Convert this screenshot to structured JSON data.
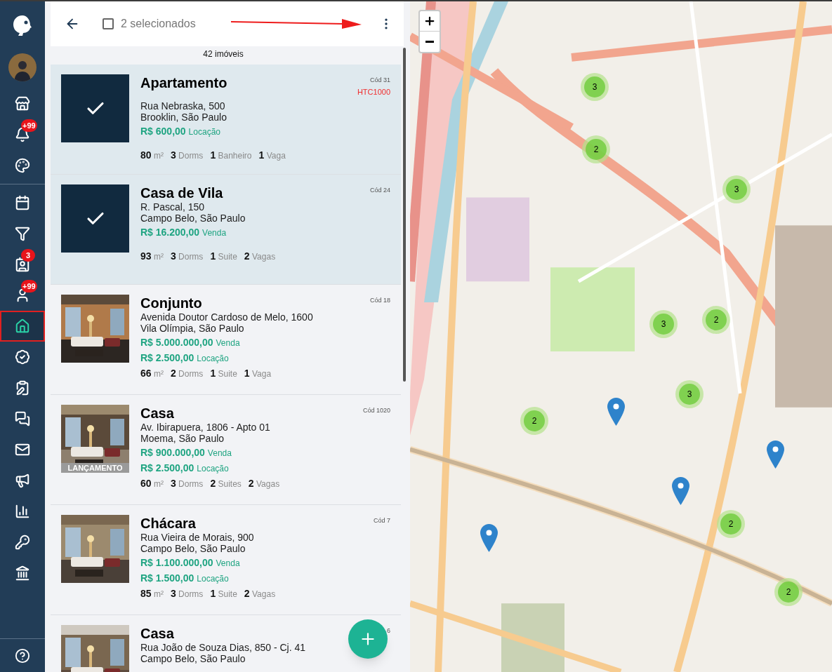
{
  "sidebar": {
    "items": [
      {
        "selected": false
      },
      {
        "badge": "+99",
        "selected": false
      },
      {
        "selected": false
      },
      {
        "selected": false
      },
      {
        "selected": false
      },
      {
        "badge": "3",
        "selected": false
      },
      {
        "badge": "+99",
        "selected": false
      },
      {
        "selected": true
      },
      {
        "selected": false
      },
      {
        "selected": false
      },
      {
        "selected": false
      },
      {
        "selected": false
      },
      {
        "selected": false
      },
      {
        "selected": false
      },
      {
        "selected": false
      },
      {
        "selected": false
      }
    ]
  },
  "header": {
    "select_all_checked": false,
    "selection_label": "2 selecionados"
  },
  "count_label": "42 imóveis",
  "listings": [
    {
      "title": "Apartamento",
      "code": "Cód 31",
      "ref": "HTC1000",
      "selected": true,
      "address": [
        "Rua Nebraska, 500",
        "Brooklin, São Paulo"
      ],
      "prices": [
        {
          "amount": "R$ 600,00",
          "type": "Locação"
        }
      ],
      "stats": [
        "**80** m²",
        "**3** Dorms",
        "**1** Banheiro",
        "**1** Vaga"
      ]
    },
    {
      "title": "Casa de Vila",
      "code": "Cód 24",
      "selected": true,
      "address": [
        "R. Pascal, 150",
        "Campo Belo, São Paulo"
      ],
      "prices": [
        {
          "amount": "R$ 16.200,00",
          "type": "Venda"
        }
      ],
      "stats": [
        "**93** m²",
        "**3** Dorms",
        "**1** Suite",
        "**2** Vagas"
      ]
    },
    {
      "title": "Conjunto",
      "code": "Cód 18",
      "selected": false,
      "address": [
        "Avenida Doutor Cardoso de Melo, 1600",
        "Vila Olímpia, São Paulo"
      ],
      "prices": [
        {
          "amount": "R$ 5.000.000,00",
          "type": "Venda"
        },
        {
          "amount": "R$ 2.500,00",
          "type": "Locação"
        }
      ],
      "stats": [
        "**66** m²",
        "**2** Dorms",
        "**1** Suite",
        "**1** Vaga"
      ]
    },
    {
      "title": "Casa",
      "code": "Cód 1020",
      "selected": false,
      "badge": "LANÇAMENTO",
      "address": [
        "Av. Ibirapuera, 1806 - Apto 01",
        "Moema, São Paulo"
      ],
      "prices": [
        {
          "amount": "R$ 900.000,00",
          "type": "Venda"
        },
        {
          "amount": "R$ 2.500,00",
          "type": "Locação"
        }
      ],
      "stats": [
        "**60** m²",
        "**3** Dorms",
        "**2** Suites",
        "**2** Vagas"
      ]
    },
    {
      "title": "Chácara",
      "code": "Cód 7",
      "selected": false,
      "address": [
        "Rua Vieira de Morais, 900",
        "Campo Belo, São Paulo"
      ],
      "prices": [
        {
          "amount": "R$ 1.100.000,00",
          "type": "Venda"
        },
        {
          "amount": "R$ 1.500,00",
          "type": "Locação"
        }
      ],
      "stats": [
        "**85** m²",
        "**3** Dorms",
        "**1** Suite",
        "**2** Vagas"
      ]
    },
    {
      "title": "Casa",
      "code": "6",
      "selected": false,
      "address": [
        "Rua João de Souza Dias, 850 - Cj. 41",
        "Campo Belo, São Paulo"
      ]
    }
  ],
  "map": {
    "clusters": [
      "3",
      "2",
      "3",
      "3",
      "2",
      "3",
      "2",
      "2",
      "2"
    ]
  }
}
